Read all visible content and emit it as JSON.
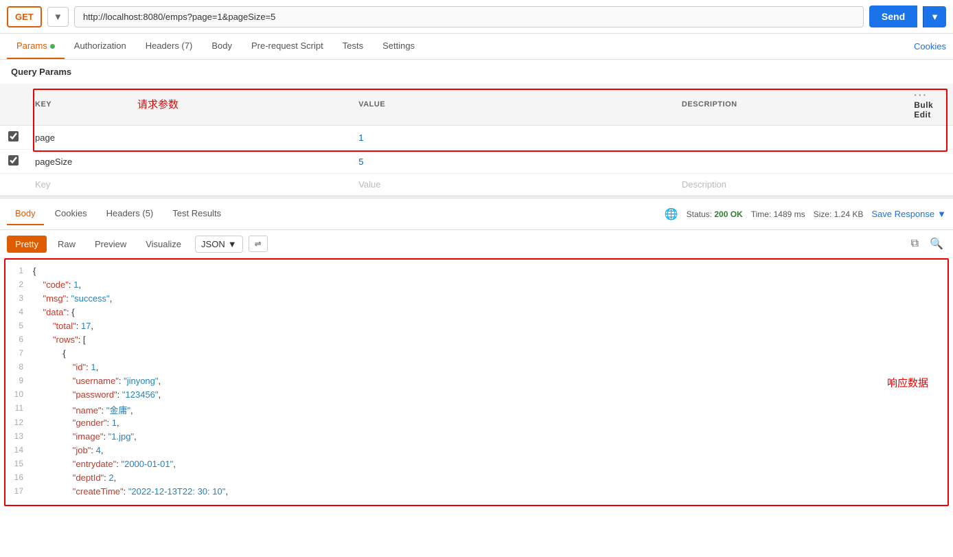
{
  "topbar": {
    "method": "GET",
    "url": "http://localhost:8080/emps?page=1&pageSize=5",
    "send_label": "Send",
    "dropdown_arrow": "▼"
  },
  "tabs": {
    "items": [
      {
        "label": "Params",
        "active": true,
        "dot": true
      },
      {
        "label": "Authorization",
        "active": false
      },
      {
        "label": "Headers (7)",
        "active": false
      },
      {
        "label": "Body",
        "active": false
      },
      {
        "label": "Pre-request Script",
        "active": false
      },
      {
        "label": "Tests",
        "active": false
      },
      {
        "label": "Settings",
        "active": false
      }
    ],
    "cookies": "Cookies"
  },
  "query_params": {
    "title": "Query Params",
    "columns": {
      "key": "KEY",
      "value": "VALUE",
      "description": "DESCRIPTION"
    },
    "rows": [
      {
        "checked": true,
        "key": "page",
        "value": "1",
        "description": ""
      },
      {
        "checked": true,
        "key": "pageSize",
        "value": "5",
        "description": ""
      }
    ],
    "empty_row": {
      "key_placeholder": "Key",
      "value_placeholder": "Value",
      "desc_placeholder": "Description"
    },
    "annotation_label": "请求参数"
  },
  "response": {
    "tabs": [
      {
        "label": "Body",
        "active": true
      },
      {
        "label": "Cookies",
        "active": false
      },
      {
        "label": "Headers (5)",
        "active": false
      },
      {
        "label": "Test Results",
        "active": false
      }
    ],
    "status": "Status:",
    "status_value": "200 OK",
    "time": "Time: 1489 ms",
    "size": "Size: 1.24 KB",
    "save_response": "Save Response",
    "format_tabs": [
      {
        "label": "Pretty",
        "active": true
      },
      {
        "label": "Raw",
        "active": false
      },
      {
        "label": "Preview",
        "active": false
      },
      {
        "label": "Visualize",
        "active": false
      }
    ],
    "format_select": "JSON",
    "annotation_label": "响应数据",
    "code_lines": [
      {
        "num": 1,
        "content": "{"
      },
      {
        "num": 2,
        "content": "    \"code\": 1,"
      },
      {
        "num": 3,
        "content": "    \"msg\": \"success\","
      },
      {
        "num": 4,
        "content": "    \"data\": {"
      },
      {
        "num": 5,
        "content": "        \"total\": 17,"
      },
      {
        "num": 6,
        "content": "        \"rows\": ["
      },
      {
        "num": 7,
        "content": "            {"
      },
      {
        "num": 8,
        "content": "                \"id\": 1,"
      },
      {
        "num": 9,
        "content": "                \"username\": \"jinyong\","
      },
      {
        "num": 10,
        "content": "                \"password\": \"123456\","
      },
      {
        "num": 11,
        "content": "                \"name\": \"金庸\","
      },
      {
        "num": 12,
        "content": "                \"gender\": 1,"
      },
      {
        "num": 13,
        "content": "                \"image\": \"1.jpg\","
      },
      {
        "num": 14,
        "content": "                \"job\": 4,"
      },
      {
        "num": 15,
        "content": "                \"entrydate\": \"2000-01-01\","
      },
      {
        "num": 16,
        "content": "                \"deptId\": 2,"
      },
      {
        "num": 17,
        "content": "                \"createTime\": \"2022-12-13T22:30:10\","
      }
    ]
  }
}
